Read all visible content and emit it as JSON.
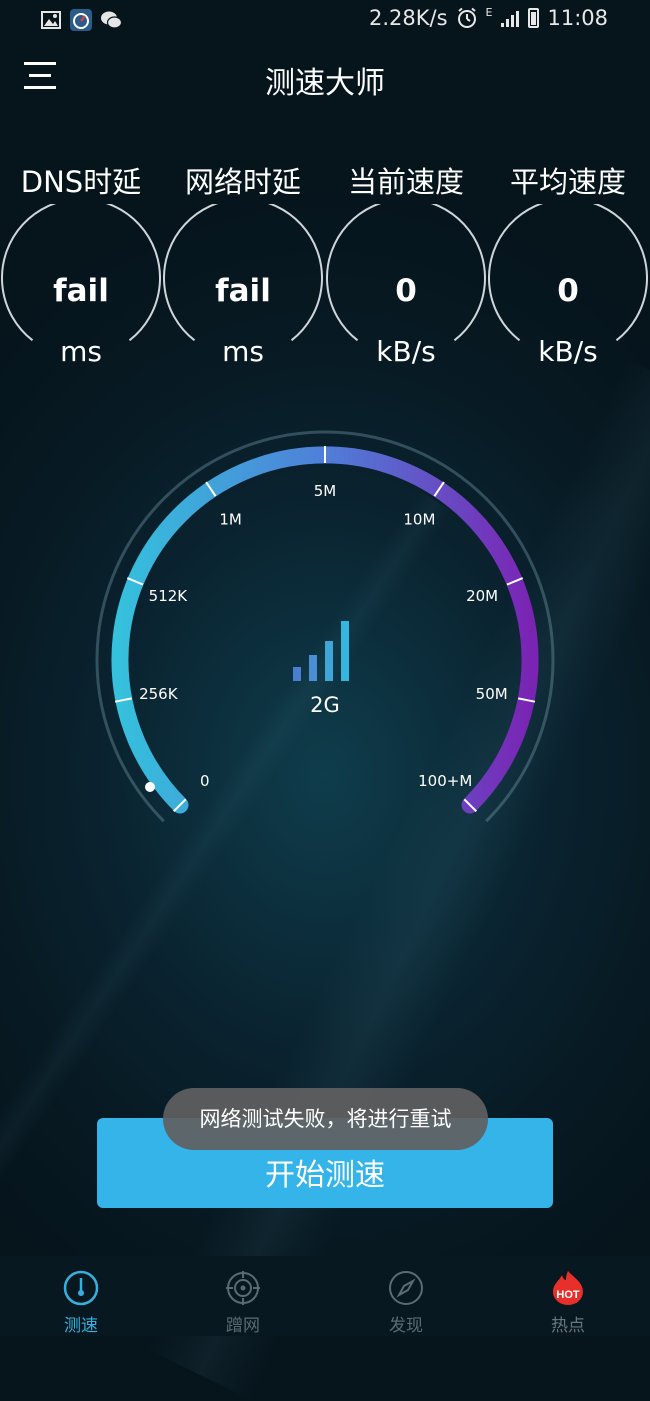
{
  "status_bar": {
    "net_speed": "2.28K/s",
    "time": "11:08",
    "network_indicator": "E",
    "icons": [
      "image-icon",
      "speedometer-app-icon",
      "wechat-icon",
      "alarm-icon",
      "signal-icon",
      "battery-icon"
    ]
  },
  "header": {
    "title": "测速大师",
    "menu_icon": "hamburger-icon"
  },
  "stats": [
    {
      "label": "DNS时延",
      "value": "fail",
      "unit": "ms"
    },
    {
      "label": "网络时延",
      "value": "fail",
      "unit": "ms"
    },
    {
      "label": "当前速度",
      "value": "0",
      "unit": "kB/s"
    },
    {
      "label": "平均速度",
      "value": "0",
      "unit": "kB/s"
    }
  ],
  "gauge": {
    "ticks": [
      "0",
      "256K",
      "512K",
      "1M",
      "5M",
      "10M",
      "20M",
      "50M",
      "100+M"
    ],
    "network_type": "2G",
    "current_speed_fraction": 0,
    "colors": {
      "start": "#35c0dc",
      "mid": "#4f7fd8",
      "end": "#7a24b4"
    }
  },
  "start_button": {
    "label": "开始测速"
  },
  "toast": {
    "message": "网络测试失败，将进行重试"
  },
  "bottom_nav": [
    {
      "label": "测速",
      "icon": "speedometer-icon",
      "active": true
    },
    {
      "label": "蹭网",
      "icon": "target-icon",
      "active": false
    },
    {
      "label": "发现",
      "icon": "compass-icon",
      "active": false
    },
    {
      "label": "热点",
      "icon": "hot-icon",
      "badge": "HOT",
      "active": false
    }
  ],
  "colors": {
    "accent": "#34b4e8",
    "active_nav": "#35b0dd",
    "hot": "#e8302a"
  }
}
